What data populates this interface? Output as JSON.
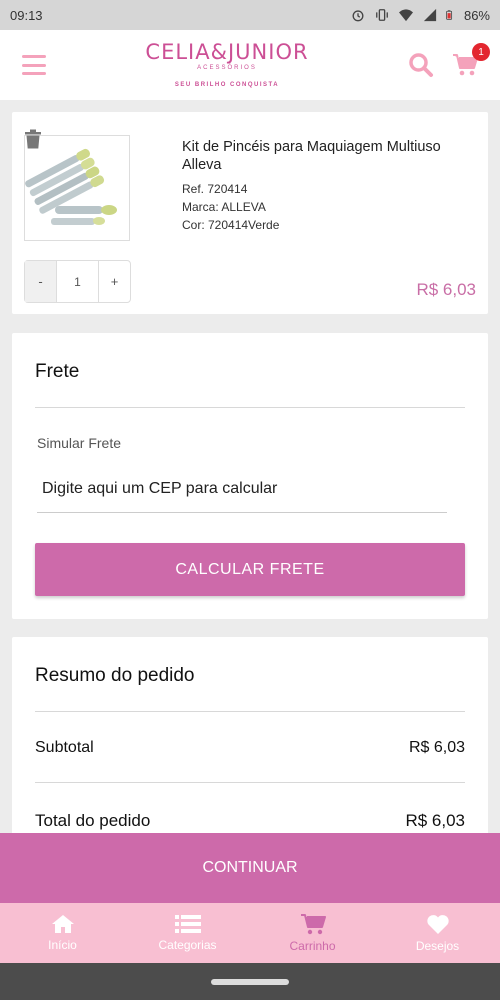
{
  "status_bar": {
    "time": "09:13",
    "battery": "86%"
  },
  "header": {
    "brand_name": "CELIA&JUNIOR",
    "brand_sub": "ACESSÓRIOS",
    "brand_tag": "SEU BRILHO CONQUISTA",
    "cart_count": "1"
  },
  "product": {
    "title": "Kit de Pincéis para Maquiagem Multiuso Alleva",
    "ref": "Ref. 720414",
    "brand": "Marca: ALLEVA",
    "color": "Cor: 720414Verde",
    "qty_minus": "-",
    "qty_value": "1",
    "qty_plus": "+",
    "price": "R$ 6,03"
  },
  "frete": {
    "title": "Frete",
    "simular_label": "Simular Frete",
    "cep_placeholder": "Digite aqui um CEP para calcular",
    "button": "CALCULAR FRETE"
  },
  "resumo": {
    "title": "Resumo do pedido",
    "subtotal_label": "Subtotal",
    "subtotal_value": "R$ 6,03",
    "total_label": "Total do pedido",
    "total_value": "R$ 6,03"
  },
  "continue_button": "CONTINUAR",
  "bottom_nav": [
    {
      "label": "Início",
      "icon": "home-icon"
    },
    {
      "label": "Categorias",
      "icon": "list-icon"
    },
    {
      "label": "Carrinho",
      "icon": "cart-icon"
    },
    {
      "label": "Desejos",
      "icon": "heart-icon"
    }
  ],
  "colors": {
    "accent": "#cd6aaa",
    "nav_bg": "#f8bfd2",
    "brand": "#cc4f95",
    "badge": "#e3262f"
  }
}
